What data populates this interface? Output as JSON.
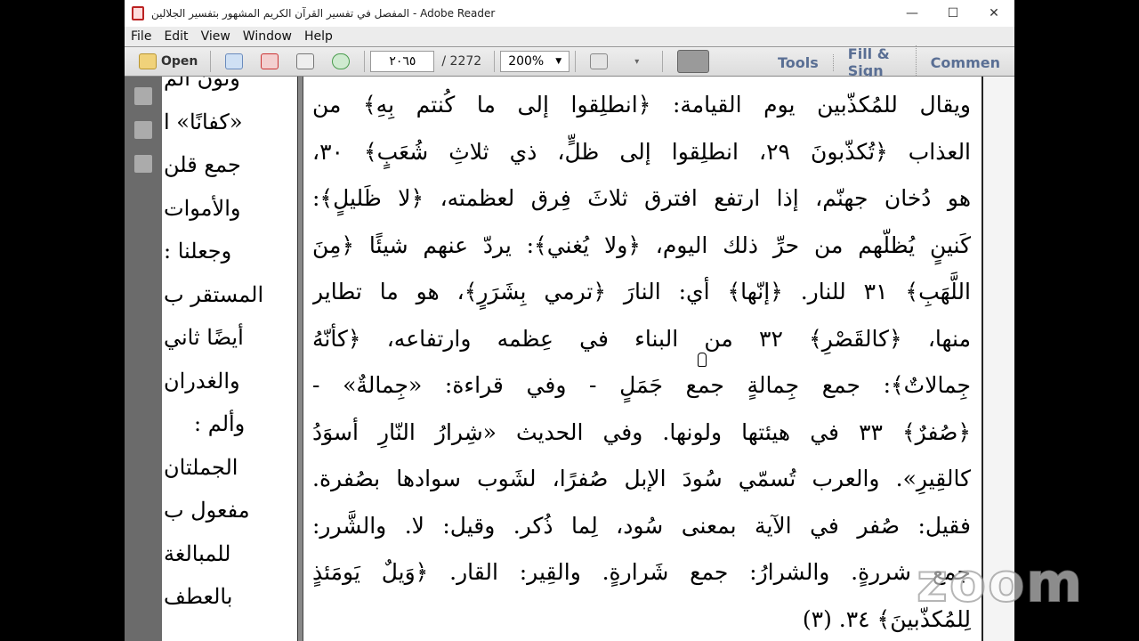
{
  "window": {
    "title": "المفصل في تفسير القرآن الكريم المشهور بتفسير الجلالين - Adobe Reader",
    "controls": [
      "—",
      "☐",
      "✕"
    ]
  },
  "menu": [
    "File",
    "Edit",
    "View",
    "Window",
    "Help"
  ],
  "toolbar": {
    "open": "Open",
    "page_current": "٢٠٦٥",
    "page_total": "/ 2272",
    "zoom": "200%",
    "tools": "Tools",
    "fill_sign": "Fill & Sign",
    "comment": "Commen"
  },
  "left_page": [
    "ونون الم",
    "«كفانًا» ا",
    "جمع قلن",
    "والأموات",
    "وجعلنا :",
    "المستقر ب",
    "أيضًا ثاني",
    "والغدران",
    "وألم :",
    "الجملتان",
    "مفعول ب",
    "للمبالغة",
    "بالعطف"
  ],
  "main_page": [
    "ويقال للمُكذّبين يوم القيامة: ﴿انطلِقوا إلى ما كُنتم بِهِ﴾ من",
    "العذاب ﴿تُكذّبونَ ٢٩، انطلِقوا إلى ظلٍّ، ذي ثلاثِ شُعَبٍ﴾ ٣٠،",
    "هو دُخان جهنّم، إذا ارتفع افترق ثلاثَ فِرق لعظمته، ﴿لا ظَليلٍ﴾:",
    "كَنينٍ يُظلّهم من حرِّ ذلك اليوم، ﴿ولا يُغني﴾: يردّ عنهم شيئًا ﴿مِنَ",
    "اللَّهَبِ﴾ ٣١ للنار. ﴿إنّها﴾ أي: النارَ ﴿ترمي بِشَرَرٍ﴾، هو ما تطاير",
    "منها، ﴿كالقَصْرِ﴾ ٣٢ من البناء في عِظمه وارتفاعه، ﴿كأنّهُ",
    "جِمالاتٌ﴾: جمع جِمالةٍ جمع جَمَلٍ - وفي قراءة: «جِمالةٌ» -",
    "﴿صُفرٌ﴾ ٣٣ في هيئتها ولونها. وفي الحديث «شِرارُ النّارِ أسوَدُ",
    "كالقِيرِ». والعرب تُسمّي سُودَ الإبل صُفرًا، لشَوب سوادها بصُفرة.",
    "فقيل: صُفر في الآية بمعنى سُود، لِما ذُكر. وقيل: لا. والشَّرر:",
    "جمع شررةٍ. والشرارُ: جمع شَرارةٍ. والقِير: القار. ﴿وَيلٌ يَومَئذٍ",
    "لِلمُكذّبينَ﴾ ٣٤. (٣)"
  ],
  "watermark": "zoom"
}
